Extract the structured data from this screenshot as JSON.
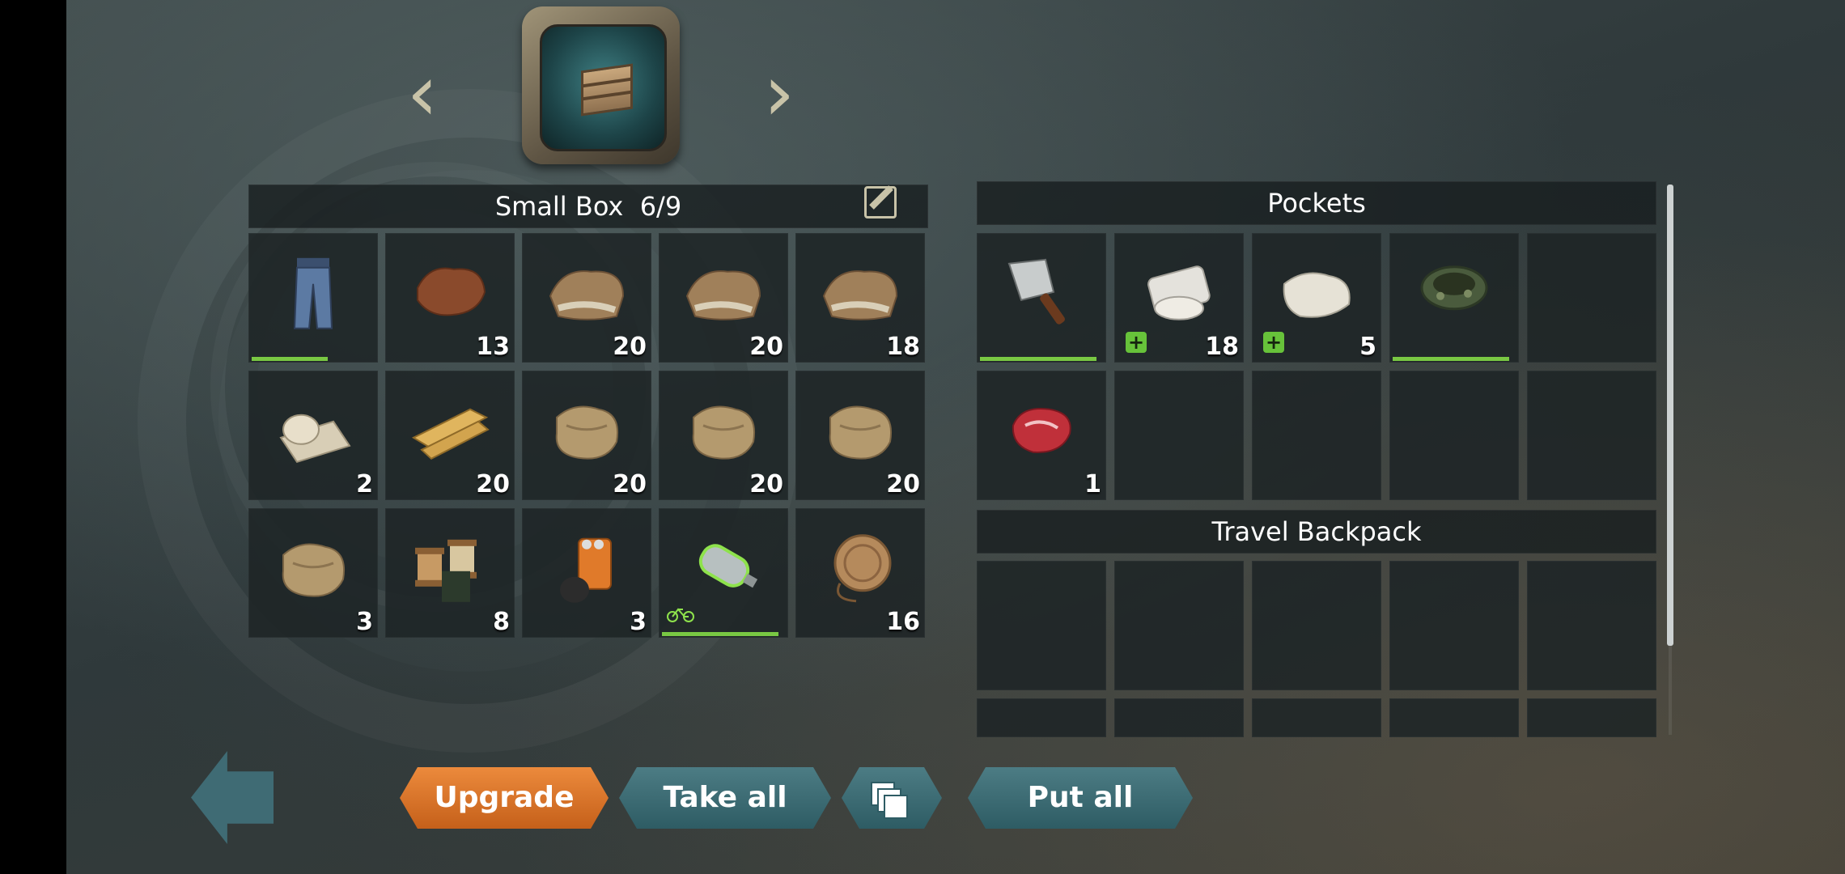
{
  "colors": {
    "accent_orange": "#d9712a",
    "accent_teal": "#3a6a72",
    "durability_green": "#79c843",
    "medkit_green": "#67c23a"
  },
  "selector": {
    "prev_icon": "chevron-left-icon",
    "next_icon": "chevron-right-icon",
    "container_icon": "crate-monitor-icon"
  },
  "small_box": {
    "title": "Small Box  6/9",
    "edit_icon": "pencil-edit-icon",
    "slots": [
      {
        "name": "jeans",
        "icon": "jeans-icon",
        "count": "",
        "durability": 0.62
      },
      {
        "name": "leather",
        "icon": "leather-hide-icon",
        "count": "13"
      },
      {
        "name": "rawhide",
        "icon": "rawhide-icon",
        "count": "20"
      },
      {
        "name": "rawhide",
        "icon": "rawhide-icon",
        "count": "20"
      },
      {
        "name": "rawhide",
        "icon": "rawhide-icon",
        "count": "18"
      },
      {
        "name": "bandage-roll",
        "icon": "bandage-roll-icon",
        "count": "2"
      },
      {
        "name": "planks",
        "icon": "planks-icon",
        "count": "20"
      },
      {
        "name": "cloth",
        "icon": "cloth-icon",
        "count": "20"
      },
      {
        "name": "cloth",
        "icon": "cloth-icon",
        "count": "20"
      },
      {
        "name": "cloth",
        "icon": "cloth-icon",
        "count": "20"
      },
      {
        "name": "cloth",
        "icon": "cloth-icon",
        "count": "3"
      },
      {
        "name": "thread",
        "icon": "thread-spool-icon",
        "count": "8"
      },
      {
        "name": "iodine-pills",
        "icon": "pill-bottle-icon",
        "count": "3"
      },
      {
        "name": "air-tank",
        "icon": "air-tank-icon",
        "count": "",
        "durability": 0.95,
        "bike": true
      },
      {
        "name": "rope",
        "icon": "rope-icon",
        "count": "16"
      }
    ]
  },
  "pockets": {
    "title": "Pockets",
    "slots": [
      {
        "name": "cleaver",
        "icon": "cleaver-icon",
        "count": "",
        "durability": 0.95
      },
      {
        "name": "bandage",
        "icon": "bandage-icon",
        "count": "18",
        "med": true
      },
      {
        "name": "cloth-rags",
        "icon": "rags-icon",
        "count": "5",
        "med": true
      },
      {
        "name": "camo-headband",
        "icon": "headband-icon",
        "count": "",
        "durability": 0.95
      },
      {
        "name": "empty",
        "icon": "",
        "count": ""
      },
      {
        "name": "raw-meat",
        "icon": "raw-meat-icon",
        "count": "1"
      },
      {
        "name": "empty",
        "icon": "",
        "count": ""
      },
      {
        "name": "empty",
        "icon": "",
        "count": ""
      },
      {
        "name": "empty",
        "icon": "",
        "count": ""
      },
      {
        "name": "empty",
        "icon": "",
        "count": ""
      }
    ]
  },
  "backpack": {
    "title": "Travel Backpack",
    "slot_count": 10
  },
  "buttons": {
    "back_icon": "back-arrow-icon",
    "upgrade": "Upgrade",
    "take_all": "Take all",
    "stack_icon": "stack-icon",
    "put_all": "Put all"
  }
}
